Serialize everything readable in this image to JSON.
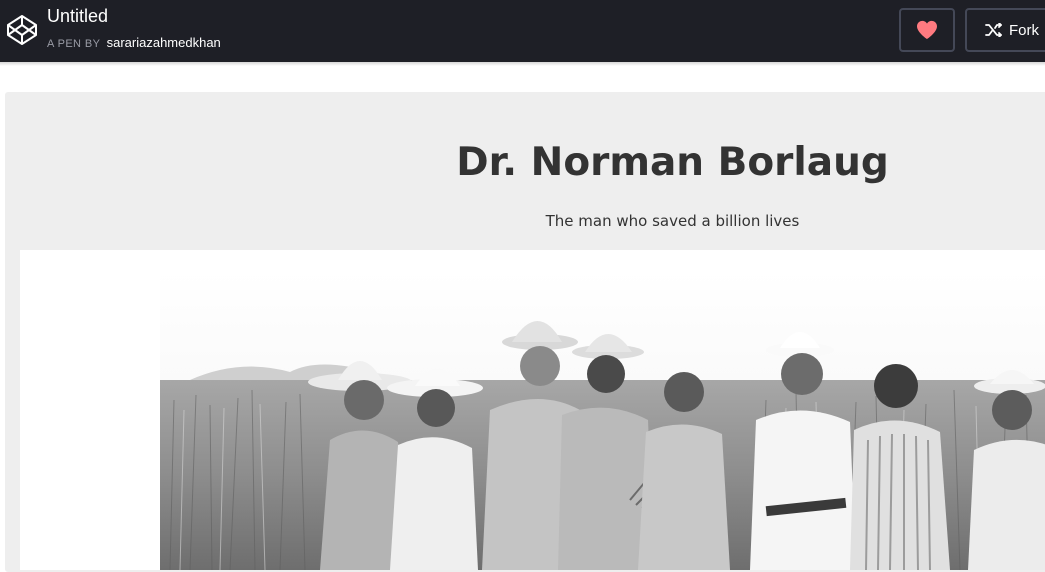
{
  "header": {
    "title": "Untitled",
    "byline_prefix": "A PEN BY",
    "author": "sarariazahmedkhan",
    "fork_label": "Fork",
    "heart_color": "#ff7a80"
  },
  "preview": {
    "heading": "Dr. Norman Borlaug",
    "subheading": "The man who saved a billion lives",
    "image_alt": "Norman Borlaug with farmers in a wheat field"
  },
  "icons": {
    "logo": "codepen-logo-icon",
    "heart": "heart-icon",
    "fork": "fork-icon"
  }
}
